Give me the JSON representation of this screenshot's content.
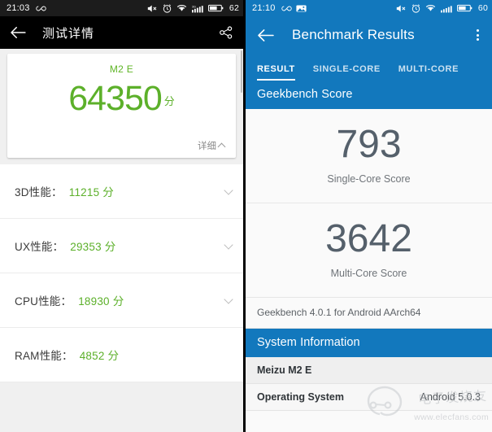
{
  "left": {
    "status": {
      "time": "21:03",
      "infinity_icon": "infinity-icon",
      "mute_icon": "volume-mute-icon",
      "alarm_icon": "alarm-clock-icon",
      "wifi_icon": "wifi-icon",
      "signal_icon": "cellular-signal-icon",
      "battery_icon": "battery-icon",
      "battery": "62"
    },
    "appbar": {
      "back_icon": "back-arrow-icon",
      "title": "测试详情",
      "share_icon": "share-icon"
    },
    "card": {
      "device": "M2 E",
      "score": "64350",
      "unit": "分",
      "detail_label": "详细",
      "detail_chevron": "chevron-up-icon"
    },
    "metrics": [
      {
        "label": "3D性能：",
        "value": "11215 分",
        "chevron": "chevron-down-icon"
      },
      {
        "label": "UX性能：",
        "value": "29353 分",
        "chevron": "chevron-down-icon"
      },
      {
        "label": "CPU性能：",
        "value": "18930 分",
        "chevron": "chevron-down-icon"
      },
      {
        "label": "RAM性能：",
        "value": "4852 分",
        "chevron": "chevron-down-icon"
      }
    ],
    "colors": {
      "accent_green": "#5cb02a",
      "appbar_bg": "#000000",
      "page_bg": "#f0f0f0"
    }
  },
  "right": {
    "status": {
      "time": "21:10",
      "infinity_icon": "infinity-icon",
      "screenshot_icon": "screenshot-icon",
      "mute_icon": "volume-mute-icon",
      "alarm_icon": "alarm-clock-icon",
      "wifi_icon": "wifi-icon",
      "signal_icon": "cellular-signal-icon",
      "battery_icon": "battery-icon",
      "battery": "60"
    },
    "appbar": {
      "back_icon": "back-arrow-icon",
      "title": "Benchmark Results",
      "overflow_icon": "more-vertical-icon"
    },
    "tabs": [
      {
        "label": "RESULT",
        "active": true
      },
      {
        "label": "SINGLE-CORE",
        "active": false
      },
      {
        "label": "MULTI-CORE",
        "active": false
      }
    ],
    "score_section_title": "Geekbench Score",
    "scores": [
      {
        "value": "793",
        "label": "Single-Core Score"
      },
      {
        "value": "3642",
        "label": "Multi-Core Score"
      }
    ],
    "version": "Geekbench 4.0.1 for Android AArch64",
    "system_section_title": "System Information",
    "system_rows": [
      {
        "key": "Meizu M2 E",
        "value": ""
      },
      {
        "key": "Operating System",
        "value": "Android 5.0.3"
      }
    ],
    "colors": {
      "accent_blue": "#1278bd",
      "page_bg": "#fafafa"
    }
  },
  "watermark": {
    "brand": "电子发烧友",
    "url": "www.elecfans.com",
    "logo_icon": "elecfans-logo-icon"
  }
}
